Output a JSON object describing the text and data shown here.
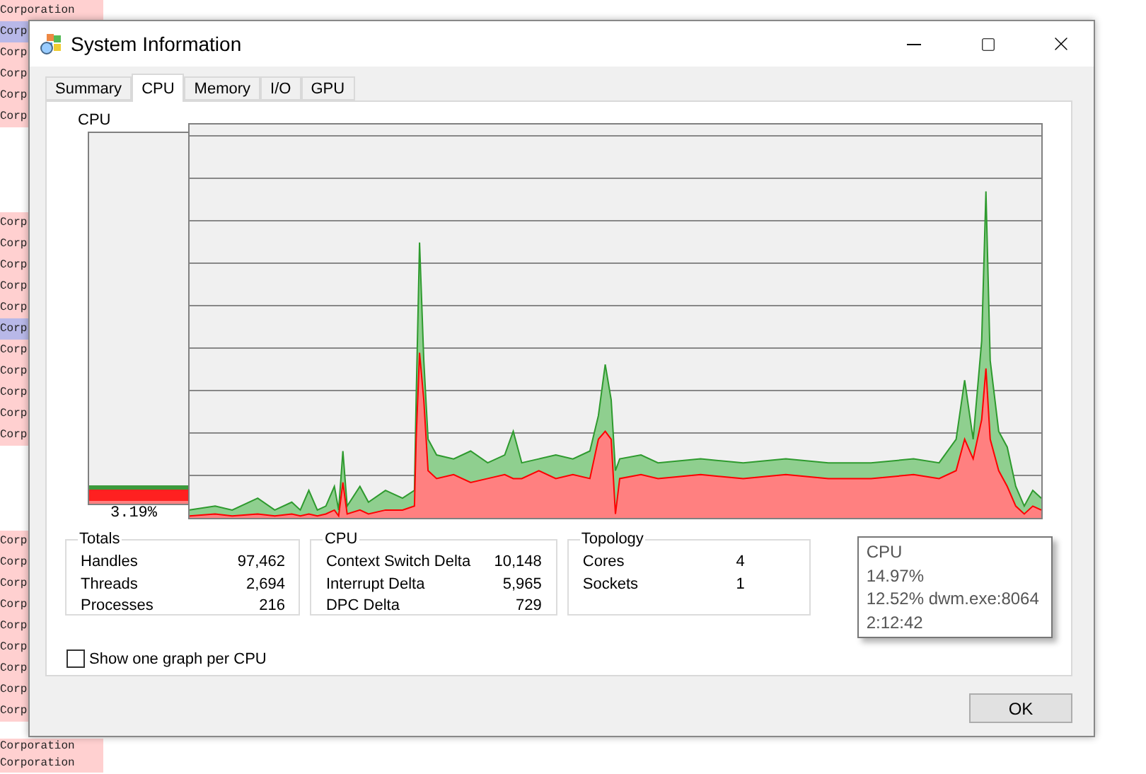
{
  "background_list": {
    "blocks": [
      {
        "rows": [
          {
            "text": "Corporation",
            "selected": false
          },
          {
            "text": "Corp",
            "selected": true
          },
          {
            "text": "Corp",
            "selected": false
          },
          {
            "text": "Corp",
            "selected": false
          },
          {
            "text": "Corp",
            "selected": false
          },
          {
            "text": "Corp",
            "selected": false
          }
        ]
      },
      {
        "rows": [
          {
            "text": "Corp",
            "selected": false
          },
          {
            "text": "Corp",
            "selected": false
          },
          {
            "text": "Corp",
            "selected": false
          },
          {
            "text": "Corp",
            "selected": false
          },
          {
            "text": "Corp",
            "selected": false
          },
          {
            "text": "Corp",
            "selected": true
          },
          {
            "text": "Corp",
            "selected": false
          },
          {
            "text": "Corp",
            "selected": false
          },
          {
            "text": "Corp",
            "selected": false
          },
          {
            "text": "Corp",
            "selected": false
          },
          {
            "text": "Corp",
            "selected": false
          }
        ]
      },
      {
        "rows": [
          {
            "text": "Corp",
            "selected": false
          },
          {
            "text": "Corp",
            "selected": false
          },
          {
            "text": "Corp",
            "selected": false
          },
          {
            "text": "Corp",
            "selected": false
          },
          {
            "text": "Corp",
            "selected": false
          },
          {
            "text": "Corp",
            "selected": false
          },
          {
            "text": "Corp",
            "selected": false
          },
          {
            "text": "Corp",
            "selected": false
          },
          {
            "text": "Corp",
            "selected": false
          }
        ]
      },
      {
        "rows": [
          {
            "text": "Corporation",
            "selected": false
          },
          {
            "text": "Corporation",
            "selected": false
          }
        ]
      }
    ]
  },
  "window": {
    "title": "System Information"
  },
  "tabs": [
    {
      "label": "Summary",
      "selected": false
    },
    {
      "label": "CPU",
      "selected": true
    },
    {
      "label": "Memory",
      "selected": false
    },
    {
      "label": "I/O",
      "selected": false
    },
    {
      "label": "GPU",
      "selected": false
    }
  ],
  "meter": {
    "label": "CPU",
    "level": 0.032,
    "reading": "3.19%"
  },
  "groups": [
    {
      "title": "Totals",
      "rows": [
        {
          "label": "Handles",
          "value": "97,462"
        },
        {
          "label": "Threads",
          "value": "2,694"
        },
        {
          "label": "Processes",
          "value": "216"
        }
      ]
    },
    {
      "title": "CPU",
      "rows": [
        {
          "label": "Context Switch Delta",
          "value": "10,148"
        },
        {
          "label": "Interrupt Delta",
          "value": "5,965"
        },
        {
          "label": "DPC Delta",
          "value": "729"
        }
      ]
    },
    {
      "title": "Topology",
      "rows": [
        {
          "label": "Cores",
          "value": "4"
        },
        {
          "label": "Sockets",
          "value": "1"
        }
      ]
    }
  ],
  "tooltip": {
    "lines": [
      "CPU",
      "14.97%",
      "12.52% dwm.exe:8064",
      "2:12:42"
    ]
  },
  "per_cpu_checkbox": {
    "label": "Show one graph per CPU",
    "checked": false
  },
  "ok_button": "OK"
}
